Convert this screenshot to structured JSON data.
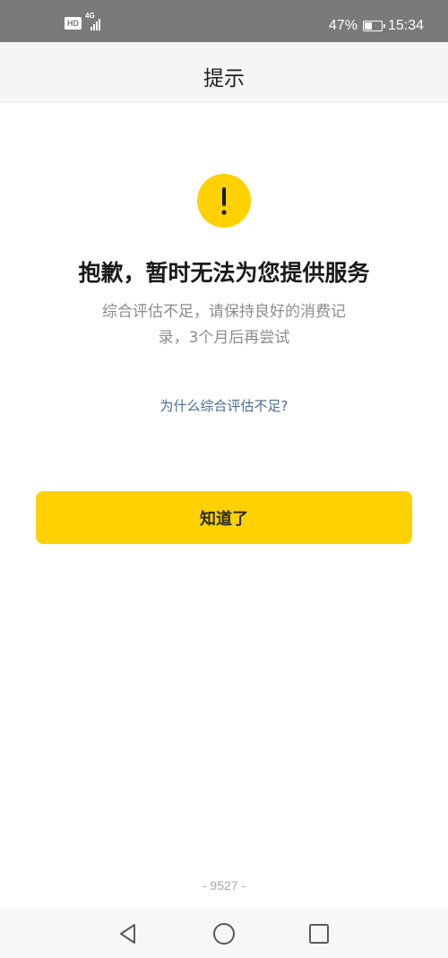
{
  "status_bar": {
    "hd_badge": "HD",
    "network_type": "4G",
    "battery_percent": "47%",
    "battery_level": 0.47,
    "time": "15:34"
  },
  "header": {
    "title": "提示"
  },
  "alert": {
    "icon": "exclamation-icon",
    "accent_color": "#ffd100",
    "headline": "抱歉，暂时无法为您提供服务",
    "description_line1": "综合评估不足，请保持良好的消费记",
    "description_line2": "录，3个月后再尝试"
  },
  "reason_link": {
    "label": "为什么综合评估不足?"
  },
  "primary_button": {
    "label": "知道了"
  },
  "footer": {
    "code": "- 9527 -"
  },
  "system_nav": {
    "back": "back-triangle-icon",
    "home": "home-circle-icon",
    "recent": "recent-square-icon"
  }
}
